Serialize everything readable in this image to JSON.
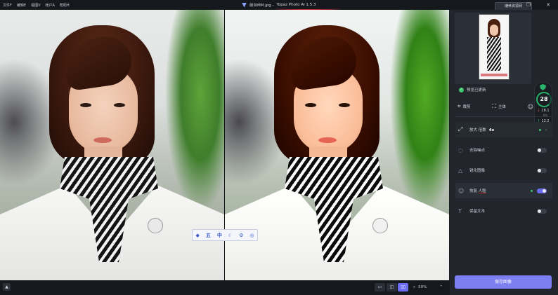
{
  "menu": [
    "文件F",
    "编辑E",
    "视图V",
    "帐户A",
    "帮助H"
  ],
  "window": {
    "title_prefix": "前台MM.jpg - ",
    "title_app": "Topaz Photo AI 1.5.3",
    "minimize": "—",
    "restore": "❐",
    "close": "✕",
    "site_button": "瑞日资源网"
  },
  "floating_toolbar": [
    "五",
    "中"
  ],
  "bottom": {
    "zoom_label": "50%",
    "zoom_icon": "magnifier-icon"
  },
  "panel": {
    "preview_status": "预览已更新",
    "tools": {
      "crop": "裁剪",
      "subject": "主体"
    },
    "meter": {
      "score": "28",
      "down_value": "18.1",
      "down_unit": "K/s",
      "up_value": "12.2",
      "up_unit": "K/s"
    },
    "upscale": {
      "label": "放大 倍数",
      "factor": "4x"
    },
    "denoise": {
      "label": "去除噪点"
    },
    "sharpen": {
      "label": "锐化图像"
    },
    "recover": {
      "label_prefix": "恢复 ",
      "label_underlined": "人脸"
    },
    "text": {
      "label": "保留文本"
    },
    "save_button": "保存图像"
  },
  "colors": {
    "accent": "#6b6cf2",
    "save_button": "#7d7ff0",
    "success": "#3ec46d",
    "panel_bg": "#22252c"
  }
}
